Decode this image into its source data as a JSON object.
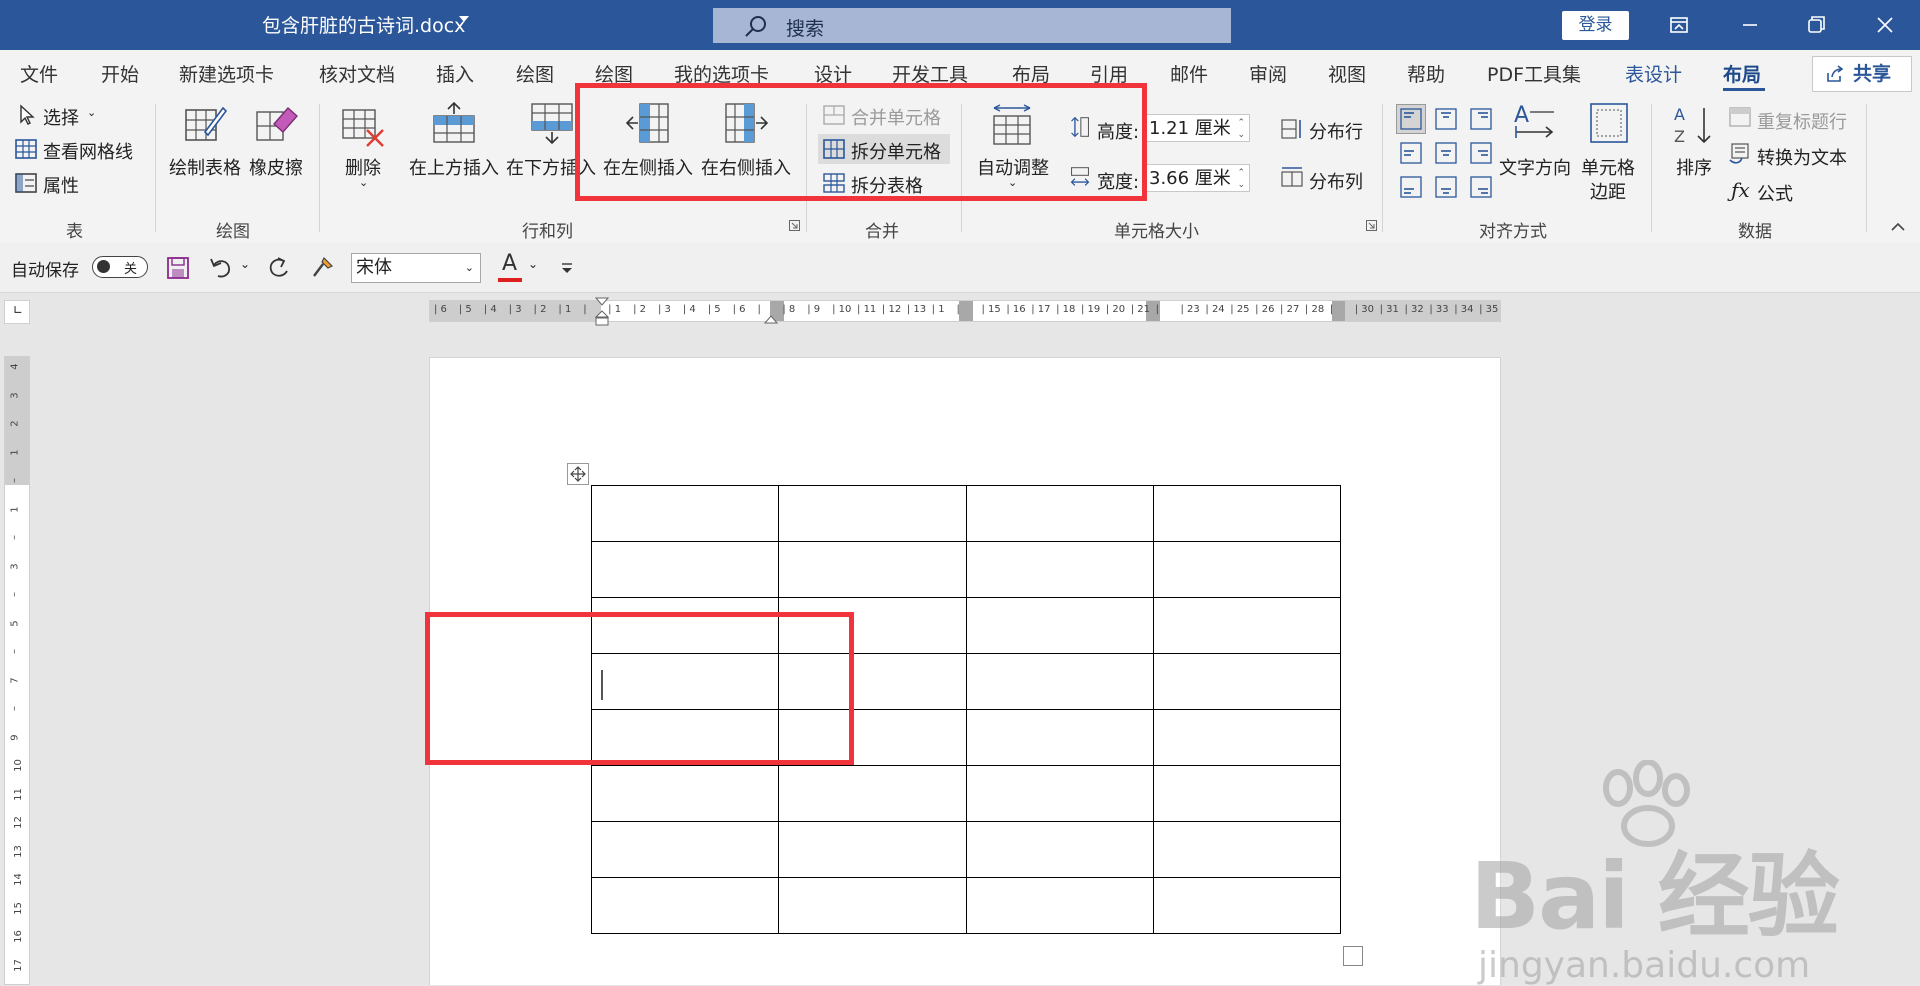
{
  "titlebar": {
    "document_title": "包含肝脏的古诗词.docx",
    "search_placeholder": "搜索",
    "login_label": "登录"
  },
  "tabs": [
    "文件",
    "开始",
    "新建选项卡",
    "核对文档",
    "插入",
    "绘图",
    "绘图",
    "我的选项卡",
    "设计",
    "开发工具",
    "布局",
    "引用",
    "邮件",
    "审阅",
    "视图",
    "帮助",
    "PDF工具集",
    "表设计",
    "布局"
  ],
  "active_tab": "布局",
  "share_label": "共享",
  "ribbon": {
    "table": {
      "title": "表",
      "select": "选择",
      "view_gridlines": "查看网格线",
      "properties": "属性"
    },
    "draw": {
      "title": "绘图",
      "draw_table": "绘制表格",
      "eraser": "橡皮擦"
    },
    "rows_cols": {
      "title": "行和列",
      "delete": "删除",
      "insert_above": "在上方插入",
      "insert_below": "在下方插入",
      "insert_left": "在左侧插入",
      "insert_right": "在右侧插入"
    },
    "merge": {
      "title": "合并",
      "merge_cells": "合并单元格",
      "split_cells": "拆分单元格",
      "split_table": "拆分表格"
    },
    "cell_size": {
      "title": "单元格大小",
      "autofit": "自动调整",
      "height_label": "高度:",
      "height_value": "1.21 厘米",
      "width_label": "宽度:",
      "width_value": "3.66 厘米",
      "distribute_rows": "分布行",
      "distribute_cols": "分布列"
    },
    "alignment": {
      "title": "对齐方式",
      "text_direction": "文字方向",
      "cell_margins_1": "单元格",
      "cell_margins_2": "边距"
    },
    "data": {
      "title": "数据",
      "sort": "排序",
      "repeat_header": "重复标题行",
      "convert_to_text": "转换为文本",
      "formula": "公式"
    }
  },
  "qat": {
    "autosave_label": "自动保存",
    "autosave_state": "关",
    "font_name": "宋体"
  },
  "hruler_labels": [
    "6",
    "5",
    "4",
    "3",
    "2",
    "1",
    "",
    "1",
    "2",
    "3",
    "4",
    "5",
    "6",
    "",
    "8",
    "9",
    "10",
    "11",
    "12",
    "13",
    "1",
    "",
    "15",
    "16",
    "17",
    "18",
    "19",
    "20",
    "21",
    "",
    "23",
    "24",
    "25",
    "26",
    "27",
    "28",
    "",
    "30",
    "31",
    "32",
    "33",
    "34",
    "35"
  ],
  "vruler_labels": [
    "4",
    "3",
    "2",
    "1",
    "",
    "1",
    "",
    "3",
    "",
    "5",
    "",
    "7",
    "",
    "9",
    "10",
    "11",
    "12",
    "13",
    "14",
    "15",
    "16",
    "17"
  ],
  "document_table": {
    "rows": 8,
    "cols": 4
  },
  "watermark": {
    "brand": "Bai  经验",
    "url": "jingyan.baidu.com"
  },
  "colors": {
    "title_bar": "#2b579a",
    "highlight_red": "#f1343c",
    "accent_blue": "#2b579a"
  }
}
